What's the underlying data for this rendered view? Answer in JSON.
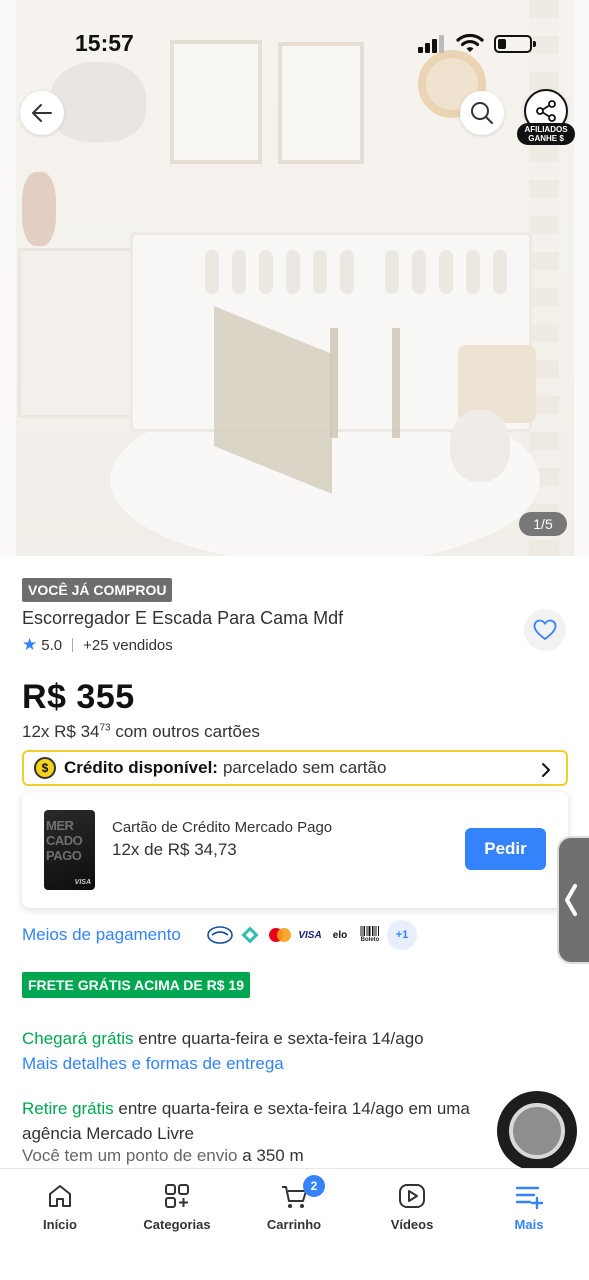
{
  "status_bar": {
    "time": "15:57"
  },
  "hero": {
    "image_counter": "1/5",
    "afiliados_line1": "AFILIADOS",
    "afiliados_line2": "GANHE $"
  },
  "product": {
    "purchased_badge": "VOCÊ JÁ COMPROU",
    "title": "Escorregador E Escada Para Cama Mdf",
    "rating": "5.0",
    "sold": "+25 vendidos",
    "price": "R$ 355",
    "installments_prefix": "12x R$ 34",
    "installments_cents": "73",
    "installments_suffix": " com outros cartões"
  },
  "credit_banner": {
    "coin": "$",
    "label": "Crédito disponível:",
    "text": "parcelado sem cartão"
  },
  "mp_card": {
    "card_art_text": "MER CADO PAGO",
    "card_brand": "VISA",
    "title": "Cartão de Crédito Mercado Pago",
    "installments": "12x de R$ 34,73",
    "button": "Pedir"
  },
  "payment": {
    "label": "Meios de pagamento",
    "methods": [
      "mercado-pago-icon",
      "pix-icon",
      "mastercard-icon",
      "VISA",
      "elo",
      "Boleto"
    ],
    "more": "+1"
  },
  "shipping": {
    "free_badge": "FRETE GRÁTIS ACIMA DE R$ 19",
    "arrival_highlight": "Chegará grátis",
    "arrival_text": " entre quarta-feira e sexta-feira 14/ago",
    "details_link": "Mais detalhes e formas de entrega",
    "pickup_highlight": "Retire grátis",
    "pickup_text": " entre quarta-feira e sexta-feira 14/ago em uma agência Mercado Livre",
    "point_text": "Você tem um ponto de envio ",
    "point_distance": "a 350 m"
  },
  "tabbar": {
    "items": [
      {
        "label": "Início",
        "icon": "home-icon"
      },
      {
        "label": "Categorias",
        "icon": "categories-icon"
      },
      {
        "label": "Carrinho",
        "icon": "cart-icon",
        "badge": "2"
      },
      {
        "label": "Vídeos",
        "icon": "video-icon"
      },
      {
        "label": "Mais",
        "icon": "menu-plus-icon",
        "active": true
      }
    ]
  },
  "colors": {
    "accent": "#3483fa",
    "green": "#00a650",
    "credit_border": "#f1d02c"
  }
}
